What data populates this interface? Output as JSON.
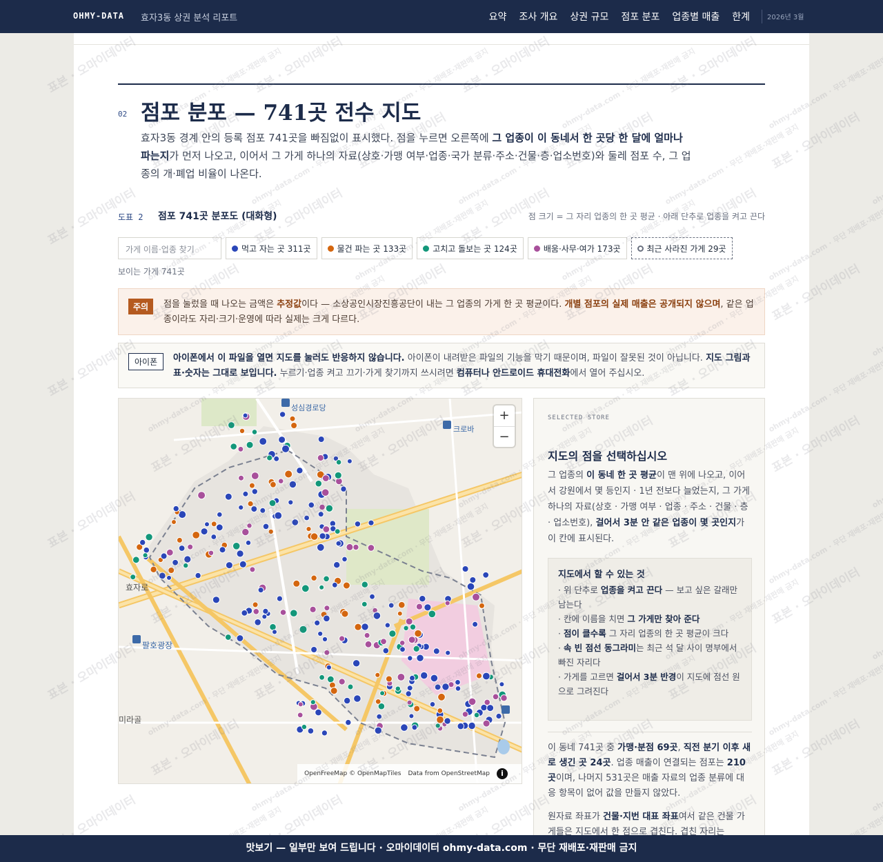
{
  "nav": {
    "brand": "OHMY-DATA",
    "report_title": "효자3동 상권 분석 리포트",
    "links": [
      "요약",
      "조사 개요",
      "상권 규모",
      "점포 분포",
      "업종별 매출",
      "한계"
    ],
    "date": "2026년 3월"
  },
  "section": {
    "number": "02",
    "title": "점포 분포 — 741곳 전수 지도",
    "lede_1": "효자3동 경계 안의 등록 점포 741곳을 빠짐없이 표시했다. 점을 누르면 오른쪽에 ",
    "lede_bold": "그 업종이 이 동네서 한 곳당 한 달에 얼마나 파는지",
    "lede_2": "가 먼저 나오고, 이어서 그 가게 하나의 자료(상호·가맹 여부·업종·국가 분류·주소·건물·층·업소번호)와 둘레 점포 수, 그 업종의 개·폐업 비율이 나온다."
  },
  "figure": {
    "label": "도표 2",
    "title": "점포 741곳 분포도 (대화형)",
    "note": "점 크기 = 그 자리 업종의 한 곳 평균 · 아래 단추로 업종을 켜고 끈다"
  },
  "search": {
    "placeholder": "가게 이름·업종 찾기"
  },
  "filters": [
    {
      "label": "먹고 자는 곳 311곳",
      "color": "#2a46b8"
    },
    {
      "label": "물건 파는 곳 133곳",
      "color": "#d4660f"
    },
    {
      "label": "고치고 돌보는 곳 124곳",
      "color": "#13977a"
    },
    {
      "label": "배움·사무·여가 173곳",
      "color": "#a8509b"
    }
  ],
  "closed_filter": {
    "label": "최근 사라진 가게 29곳"
  },
  "visible_count": "보이는 가게 741곳",
  "notice": {
    "tag": "주의",
    "text_1": "점을 눌렀을 때 나오는 금액은 ",
    "bold_1": "추정값",
    "text_2": "이다 — 소상공인시장진흥공단이 내는 그 업종의 가게 한 곳 평균이다. ",
    "bold_2": "개별 점포의 실제 매출은 공개되지 않으며",
    "text_3": ", 같은 업종이라도 자리·크기·운영에 따라 실제는 크게 다르다."
  },
  "iphone": {
    "tag": "아이폰",
    "bold_1": "아이폰에서 이 파일을 열면 지도를 눌러도 반응하지 않습니다.",
    "text_1": " 아이폰이 내려받은 파일의 기능을 막기 때문이며, 파일이 잘못된 것이 아닙니다. ",
    "bold_2": "지도 그림과 표·숫자는 그대로 보입니다.",
    "text_2": " 누르기·업종 켜고 끄기·가게 찾기까지 쓰시려면 ",
    "bold_3": "컴퓨터나 안드로이드 휴대전화",
    "text_3": "에서 열어 주십시오."
  },
  "map": {
    "labels": {
      "station": "성심경로당",
      "bus_stop": "크로바",
      "area": "팔호광장",
      "street": "효자로",
      "district": "미라골"
    },
    "zoom_in": "+",
    "zoom_out": "−",
    "attribution_1": "OpenFreeMap © OpenMapTiles",
    "attribution_2": "Data from",
    "attribution_3": "OpenStreetMap",
    "info": "i"
  },
  "panel": {
    "kicker": "SELECTED STORE",
    "title": "지도의 점을 선택하십시오",
    "body_1": "그 업종의 ",
    "body_bold_1": "이 동네 한 곳 평균",
    "body_2": "이 맨 위에 나오고, 이어서 강원에서 몇 등인지 · 1년 전보다 늘었는지, 그 가게 하나의 자료(상호 · 가맹 여부 · 업종 · 주소 · 건물 · 층 · 업소번호), ",
    "body_bold_2": "걸어서 3분 안 같은 업종이 몇 곳인지",
    "body_3": "가 이 칸에 표시된다.",
    "howto_title": "지도에서 할 수 있는 것",
    "howto": [
      {
        "pre": "· 위 단추로 ",
        "bold": "업종을 켜고 끈다",
        "post": " — 보고 싶은 갈래만 남는다"
      },
      {
        "pre": "· 칸에 이름을 치면 ",
        "bold": "그 가게만 찾아 준다",
        "post": ""
      },
      {
        "pre": "· ",
        "bold": "점이 클수록",
        "post": " 그 자리 업종의 한 곳 평균이 크다"
      },
      {
        "pre": "· ",
        "bold": "속 빈 점선 동그라미",
        "post": "는 최근 석 달 사이 명부에서 빠진 자리다"
      },
      {
        "pre": "· 가게를 고르면 ",
        "bold": "걸어서 3분 반경",
        "post": "이 지도에 점선 원으로 그려진다"
      }
    ],
    "stats_1": "이 동네 741곳 중 ",
    "stats_bold_1": "가맹·분점 69곳",
    "stats_2": ", ",
    "stats_bold_2": "직전 분기 이후 새로 생긴 곳 24곳",
    "stats_3": ". 업종 매출이 연결되는 점포는 ",
    "stats_bold_3": "210곳",
    "stats_4": "이며, 나머지 531곳은 매출 자료의 업종 분류에 대응 항목이 없어 값을 만들지 않았다.",
    "more_1": "원자료 좌표가 ",
    "more_bold": "건물·지번 대표 좌표",
    "more_2": "여서 같은 건물 가게들은 지도에서 한 점으로 겹친다. 겹친 자리는"
  },
  "watermark": {
    "main": "표본 · 오마이데이터",
    "small": "ohmy-data.com · 무단 재배포·재판매 금지"
  },
  "footer": {
    "text": "맛보기 — 일부만 보여 드립니다 · 오마이데이터 ohmy-data.com · 무단 재배포·재판매 금지"
  }
}
